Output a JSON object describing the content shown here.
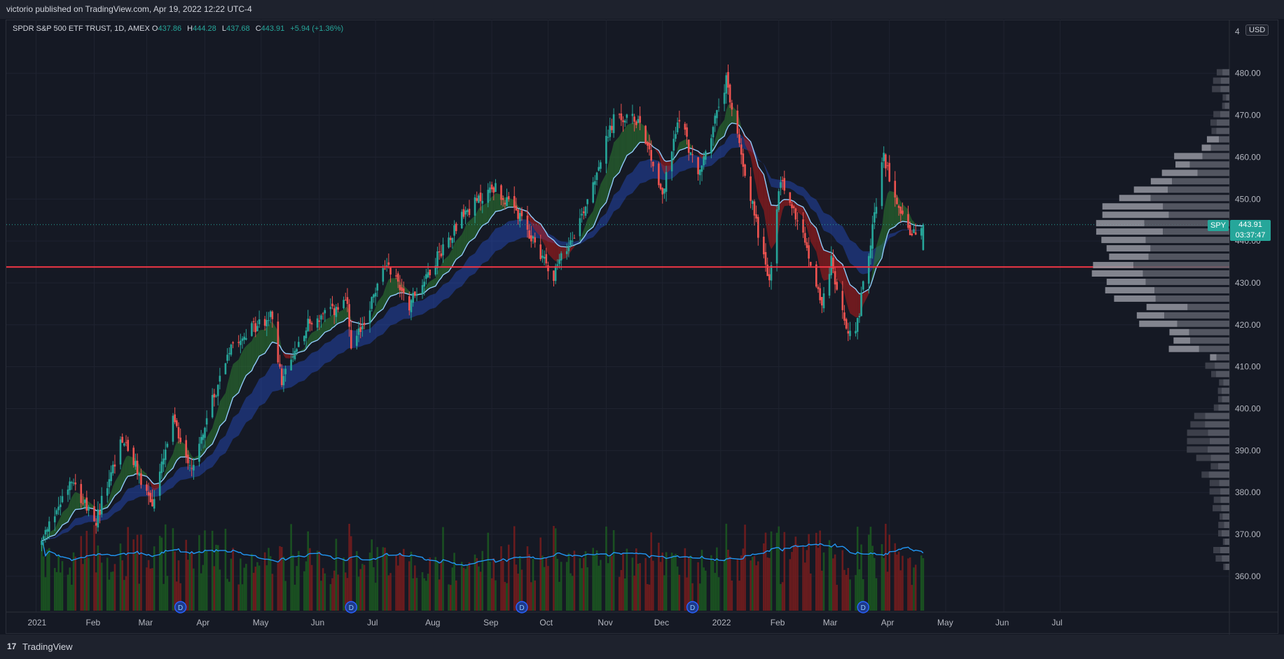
{
  "header": {
    "published_text": "victorio published on TradingView.com, Apr 19, 2022 12:22 UTC-4"
  },
  "legend": {
    "title": "SPDR S&P 500 ETF TRUST, 1D, AMEX",
    "open_label": "O",
    "open": "437.86",
    "high_label": "H",
    "high": "444.28",
    "low_label": "L",
    "low": "437.68",
    "close_label": "C",
    "close": "443.91",
    "change": "+5.94 (+1.36%)"
  },
  "currency_button": "USD",
  "price_tag": {
    "symbol": "SPY",
    "price": "443.91",
    "countdown": "03:37:47"
  },
  "footer": {
    "logo": "17",
    "brand": "TradingView"
  },
  "colors": {
    "up": "#26a69a",
    "down": "#ef5350",
    "background": "#131722",
    "ema_fast_band_up": "#2e7d32",
    "ema_band_down": "#b71c1c",
    "ema_slow_band": "#2962ff",
    "ema_line": "#90caf9",
    "support_line": "#f23645",
    "volume_ma": "#2196f3"
  },
  "chart_data": {
    "type": "candlestick",
    "y_axis": {
      "ticks": [
        480,
        470,
        460,
        450,
        440,
        430,
        420,
        410,
        400,
        390,
        380,
        370,
        360
      ],
      "top_partial_label": "4",
      "range": [
        351.6,
        489.5
      ]
    },
    "x_axis": {
      "labels": [
        "2021",
        "Feb",
        "Mar",
        "Apr",
        "May",
        "Jun",
        "Jul",
        "Aug",
        "Sep",
        "Oct",
        "Nov",
        "Dec",
        "2022",
        "Feb",
        "Mar",
        "Apr",
        "May",
        "Jun",
        "Jul"
      ]
    },
    "horizontal_line": 433.8,
    "last_price_line": 443.91,
    "dividend_marker_label": "D",
    "dividend_count": 5,
    "price_path": [
      [
        "2021-01-04",
        368
      ],
      [
        "2021-01-20",
        384
      ],
      [
        "2021-02-01",
        372
      ],
      [
        "2021-02-16",
        393
      ],
      [
        "2021-03-04",
        377
      ],
      [
        "2021-03-15",
        397
      ],
      [
        "2021-03-25",
        386
      ],
      [
        "2021-04-15",
        416
      ],
      [
        "2021-05-07",
        422
      ],
      [
        "2021-05-12",
        406
      ],
      [
        "2021-05-25",
        420
      ],
      [
        "2021-06-16",
        425
      ],
      [
        "2021-06-18",
        413
      ],
      [
        "2021-07-07",
        435
      ],
      [
        "2021-07-19",
        425
      ],
      [
        "2021-08-16",
        446
      ],
      [
        "2021-09-02",
        453
      ],
      [
        "2021-09-15",
        446
      ],
      [
        "2021-10-04",
        432
      ],
      [
        "2021-10-18",
        445
      ],
      [
        "2021-11-05",
        469
      ],
      [
        "2021-11-19",
        469
      ],
      [
        "2021-12-01",
        451
      ],
      [
        "2021-12-10",
        470
      ],
      [
        "2021-12-20",
        455
      ],
      [
        "2022-01-04",
        478
      ],
      [
        "2022-01-10",
        465
      ],
      [
        "2022-01-27",
        430
      ],
      [
        "2022-02-02",
        455
      ],
      [
        "2022-02-14",
        441
      ],
      [
        "2022-02-24",
        425
      ],
      [
        "2022-03-01",
        435
      ],
      [
        "2022-03-08",
        420
      ],
      [
        "2022-03-14",
        418
      ],
      [
        "2022-03-29",
        460
      ],
      [
        "2022-04-05",
        450
      ],
      [
        "2022-04-13",
        441
      ],
      [
        "2022-04-19",
        443.91
      ]
    ]
  }
}
